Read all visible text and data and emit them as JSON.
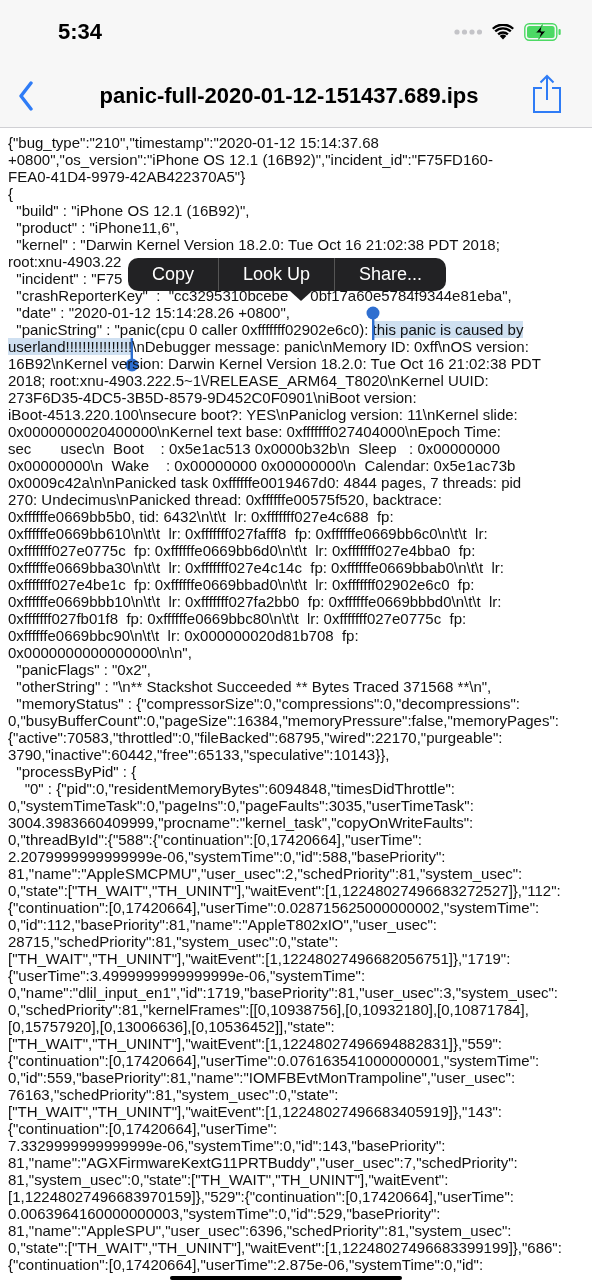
{
  "status_bar": {
    "time": "5:34"
  },
  "nav_bar": {
    "title": "panic-full-2020-01-12-151437.689.ips"
  },
  "log_lines": [
    {
      "text": "{\"bug_type\":\"210\",\"timestamp\":\"2020-01-12 15:14:37.68"
    },
    {
      "text": "+0800\",\"os_version\":\"iPhone OS 12.1 (16B92)\",\"incident_id\":\"F75FD160-"
    },
    {
      "text": "FEA0-41D4-9979-42AB422370A5\"}"
    },
    {
      "text": "{"
    },
    {
      "text": "  \"build\" : \"iPhone OS 12.1 (16B92)\","
    },
    {
      "text": "  \"product\" : \"iPhone11,6\","
    },
    {
      "text": "  \"kernel\" : \"Darwin Kernel Version 18.2.0: Tue Oct 16 21:02:38 PDT 2018;"
    },
    {
      "text": "root:xnu-4903.22"
    },
    {
      "text": "  \"incident\" : \"F75"
    },
    {
      "segments": [
        {
          "text": "  \"crashReporterKey\"  :  \"cc3295310bcebe",
          "selected": false
        },
        {
          "text": "0bf17a60e5784f9344e81eba\",",
          "selected": false,
          "covered_before": true
        }
      ]
    },
    {
      "text": "  \"date\" : \"2020-01-12 15:14:28.26 +0800\","
    },
    {
      "segments": [
        {
          "text": "  \"panicString\" : \"panic(cpu 0 caller 0xfffffff02902e6c0): ",
          "selected": false
        },
        {
          "text": "this panic is caused by",
          "selected": true,
          "handle_start": true,
          "handle_end": false
        }
      ]
    },
    {
      "segments": [
        {
          "text": "userland!!!!!!!!!!!!!!!!",
          "selected": true,
          "handle_start": false,
          "handle_end": true
        },
        {
          "text": "\\nDebugger message: panic\\nMemory ID: 0xff\\nOS version:",
          "selected": false
        }
      ]
    },
    {
      "text": "16B92\\nKernel version: Darwin Kernel Version 18.2.0: Tue Oct 16 21:02:38 PDT"
    },
    {
      "text": "2018; root:xnu-4903.222.5~1\\/RELEASE_ARM64_T8020\\nKernel UUID:"
    },
    {
      "text": "273F6D35-4DC5-3B5D-8579-9D452C0F0901\\niBoot version:"
    },
    {
      "text": "iBoot-4513.220.100\\nsecure boot?: YES\\nPaniclog version: 11\\nKernel slide:"
    },
    {
      "text": "0x0000000020400000\\nKernel text base: 0xfffffff027404000\\nEpoch Time:"
    },
    {
      "text": "sec       usec\\n  Boot    : 0x5e1ac513 0x0000b32b\\n  Sleep   : 0x00000000"
    },
    {
      "text": "0x00000000\\n  Wake    : 0x00000000 0x00000000\\n  Calendar: 0x5e1ac73b"
    },
    {
      "text": "0x0009c42a\\n\\nPanicked task 0xffffffe0019467d0: 4844 pages, 7 threads: pid"
    },
    {
      "text": "270: Undecimus\\nPanicked thread: 0xffffffe00575f520, backtrace:"
    },
    {
      "text": "0xffffffe0669bb5b0, tid: 6432\\n\\t\\t  lr: 0xfffffff027e4c688  fp:"
    },
    {
      "text": "0xffffffe0669bb610\\n\\t\\t  lr: 0xfffffff027fafff8  fp: 0xffffffe0669bb6c0\\n\\t\\t  lr:"
    },
    {
      "text": "0xfffffff027e0775c  fp: 0xffffffe0669bb6d0\\n\\t\\t  lr: 0xfffffff027e4bba0  fp:"
    },
    {
      "text": "0xffffffe0669bba30\\n\\t\\t  lr: 0xfffffff027e4c14c  fp: 0xffffffe0669bbab0\\n\\t\\t  lr:"
    },
    {
      "text": "0xfffffff027e4be1c  fp: 0xffffffe0669bbad0\\n\\t\\t  lr: 0xfffffff02902e6c0  fp:"
    },
    {
      "text": "0xffffffe0669bbb10\\n\\t\\t  lr: 0xfffffff027fa2bb0  fp: 0xffffffe0669bbbd0\\n\\t\\t  lr:"
    },
    {
      "text": "0xfffffff027fb01f8  fp: 0xffffffe0669bbc80\\n\\t\\t  lr: 0xfffffff027e0775c  fp:"
    },
    {
      "text": "0xffffffe0669bbc90\\n\\t\\t  lr: 0x000000020d81b708  fp:"
    },
    {
      "text": "0x0000000000000000\\n\\n\","
    },
    {
      "text": "  \"panicFlags\" : \"0x2\","
    },
    {
      "text": "  \"otherString\" : \"\\n** Stackshot Succeeded ** Bytes Traced 371568 **\\n\","
    },
    {
      "text": "  \"memoryStatus\" : {\"compressorSize\":0,\"compressions\":0,\"decompressions\":"
    },
    {
      "text": "0,\"busyBufferCount\":0,\"pageSize\":16384,\"memoryPressure\":false,\"memoryPages\":"
    },
    {
      "text": "{\"active\":70583,\"throttled\":0,\"fileBacked\":68795,\"wired\":22170,\"purgeable\":"
    },
    {
      "text": "3790,\"inactive\":60442,\"free\":65133,\"speculative\":10143}},"
    },
    {
      "text": "  \"processByPid\" : {"
    },
    {
      "text": "    \"0\" : {\"pid\":0,\"residentMemoryBytes\":6094848,\"timesDidThrottle\":"
    },
    {
      "text": "0,\"systemTimeTask\":0,\"pageIns\":0,\"pageFaults\":3035,\"userTimeTask\":"
    },
    {
      "text": "3004.3983660409999,\"procname\":\"kernel_task\",\"copyOnWriteFaults\":"
    },
    {
      "text": "0,\"threadById\":{\"588\":{\"continuation\":[0,17420664],\"userTime\":"
    },
    {
      "text": "2.2079999999999999e-06,\"systemTime\":0,\"id\":588,\"basePriority\":"
    },
    {
      "text": "81,\"name\":\"AppleSMCPMU\",\"user_usec\":2,\"schedPriority\":81,\"system_usec\":"
    },
    {
      "text": "0,\"state\":[\"TH_WAIT\",\"TH_UNINT\"],\"waitEvent\":[1,12248027496683272527]},\"112\":"
    },
    {
      "text": "{\"continuation\":[0,17420664],\"userTime\":0.028715625000000002,\"systemTime\":"
    },
    {
      "text": "0,\"id\":112,\"basePriority\":81,\"name\":\"AppleT802xIO\",\"user_usec\":"
    },
    {
      "text": "28715,\"schedPriority\":81,\"system_usec\":0,\"state\":"
    },
    {
      "text": "[\"TH_WAIT\",\"TH_UNINT\"],\"waitEvent\":[1,12248027496682056751]},\"1719\":"
    },
    {
      "text": "{\"userTime\":3.4999999999999999e-06,\"systemTime\":"
    },
    {
      "text": "0,\"name\":\"dlil_input_en1\",\"id\":1719,\"basePriority\":81,\"user_usec\":3,\"system_usec\":"
    },
    {
      "text": "0,\"schedPriority\":81,\"kernelFrames\":[[0,10938756],[0,10932180],[0,10871784],"
    },
    {
      "text": "[0,15757920],[0,13006636],[0,10536452]],\"state\":"
    },
    {
      "text": "[\"TH_WAIT\",\"TH_UNINT\"],\"waitEvent\":[1,12248027496694882831]},\"559\":"
    },
    {
      "text": "{\"continuation\":[0,17420664],\"userTime\":0.076163541000000001,\"systemTime\":"
    },
    {
      "text": "0,\"id\":559,\"basePriority\":81,\"name\":\"IOMFBEvtMonTrampoline\",\"user_usec\":"
    },
    {
      "text": "76163,\"schedPriority\":81,\"system_usec\":0,\"state\":"
    },
    {
      "text": "[\"TH_WAIT\",\"TH_UNINT\"],\"waitEvent\":[1,12248027496683405919]},\"143\":"
    },
    {
      "text": "{\"continuation\":[0,17420664],\"userTime\":"
    },
    {
      "text": "7.3329999999999999e-06,\"systemTime\":0,\"id\":143,\"basePriority\":"
    },
    {
      "text": "81,\"name\":\"AGXFirmwareKextG11PRTBuddy\",\"user_usec\":7,\"schedPriority\":"
    },
    {
      "text": "81,\"system_usec\":0,\"state\":[\"TH_WAIT\",\"TH_UNINT\"],\"waitEvent\":"
    },
    {
      "text": "[1,12248027496683970159]},\"529\":{\"continuation\":[0,17420664],\"userTime\":"
    },
    {
      "text": "0.0063964160000000003,\"systemTime\":0,\"id\":529,\"basePriority\":"
    },
    {
      "text": "81,\"name\":\"AppleSPU\",\"user_usec\":6396,\"schedPriority\":81,\"system_usec\":"
    },
    {
      "text": "0,\"state\":[\"TH_WAIT\",\"TH_UNINT\"],\"waitEvent\":[1,12248027496683399199]},\"686\":"
    },
    {
      "text": "{\"continuation\":[0,17420664],\"userTime\":2.875e-06,\"systemTime\":0,\"id\":"
    }
  ],
  "edit_menu": {
    "items": [
      {
        "label": "Copy"
      },
      {
        "label": "Look Up"
      },
      {
        "label": "Share..."
      }
    ]
  }
}
